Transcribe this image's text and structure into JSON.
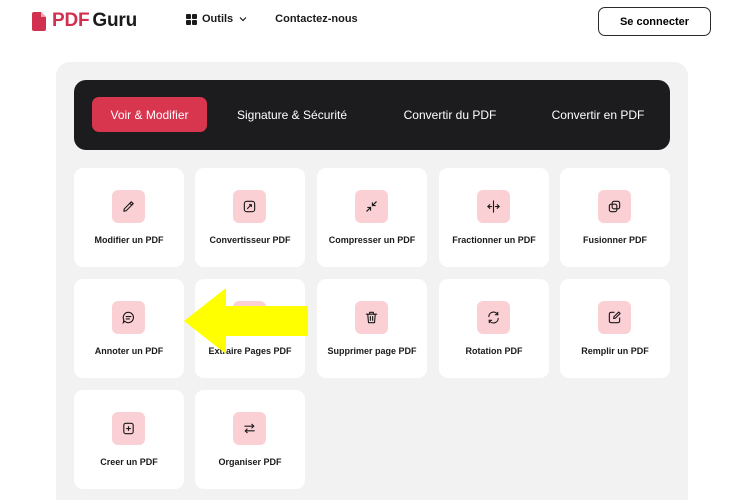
{
  "header": {
    "logo_pdf": "PDF",
    "logo_guru": "Guru",
    "nav_tools": "Outils",
    "nav_contact": "Contactez-nous",
    "login_button": "Se connecter"
  },
  "tabs": [
    {
      "label": "Voir & Modifier",
      "active": true
    },
    {
      "label": "Signature & Sécurité",
      "active": false
    },
    {
      "label": "Convertir du PDF",
      "active": false
    },
    {
      "label": "Convertir en PDF",
      "active": false
    }
  ],
  "tools": [
    {
      "label": "Modifier un PDF",
      "icon": "pencil-icon"
    },
    {
      "label": "Convertisseur PDF",
      "icon": "convert-icon"
    },
    {
      "label": "Compresser un PDF",
      "icon": "compress-icon"
    },
    {
      "label": "Fractionner un PDF",
      "icon": "split-icon"
    },
    {
      "label": "Fusionner PDF",
      "icon": "merge-icon"
    },
    {
      "label": "Annoter un PDF",
      "icon": "comment-icon"
    },
    {
      "label": "Extraire Pages PDF",
      "icon": "extract-icon"
    },
    {
      "label": "Supprimer page PDF",
      "icon": "trash-icon"
    },
    {
      "label": "Rotation PDF",
      "icon": "rotate-icon"
    },
    {
      "label": "Remplir un PDF",
      "icon": "edit-form-icon"
    },
    {
      "label": "Creer un PDF",
      "icon": "add-icon"
    },
    {
      "label": "Organiser PDF",
      "icon": "organize-icon"
    }
  ],
  "colors": {
    "accent": "#d8354f",
    "icon_bg": "#fbd0d5",
    "tab_bar": "#1c1c1e",
    "panel": "#f2f2f2",
    "annotation_arrow": "#ffff00"
  }
}
